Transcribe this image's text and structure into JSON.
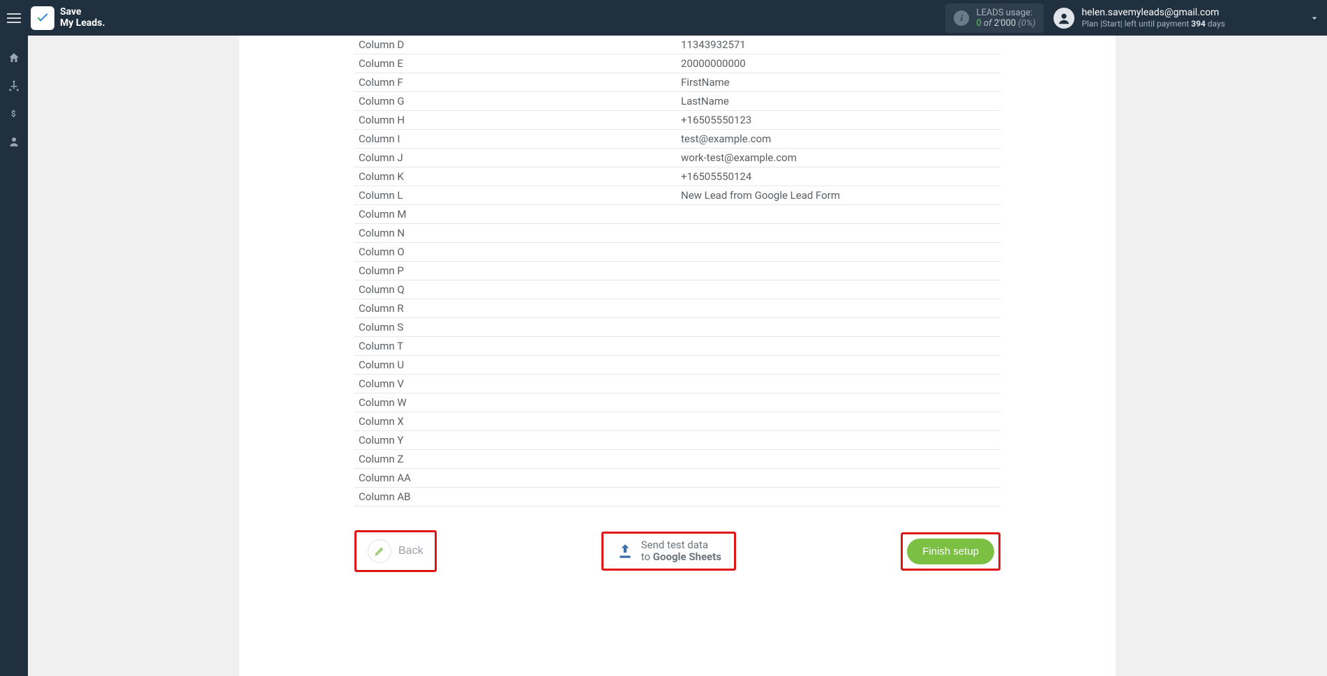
{
  "header": {
    "brand_line1": "Save",
    "brand_line2": "My Leads.",
    "leads_label": "LEADS usage:",
    "leads_value": "0",
    "leads_of": " of ",
    "leads_total": "2'000",
    "leads_pct": " (0%)",
    "user_email": "helen.savemyleads@gmail.com",
    "plan_prefix": "Plan |",
    "plan_name": "Start",
    "plan_mid": "| left until payment ",
    "plan_days_num": "394",
    "plan_days_suffix": " days"
  },
  "columns": [
    {
      "key": "Column D",
      "value": "11343932571"
    },
    {
      "key": "Column E",
      "value": "20000000000"
    },
    {
      "key": "Column F",
      "value": "FirstName"
    },
    {
      "key": "Column G",
      "value": "LastName"
    },
    {
      "key": "Column H",
      "value": "+16505550123"
    },
    {
      "key": "Column I",
      "value": "test@example.com"
    },
    {
      "key": "Column J",
      "value": "work-test@example.com"
    },
    {
      "key": "Column K",
      "value": "+16505550124"
    },
    {
      "key": "Column L",
      "value": "New Lead from Google Lead Form"
    },
    {
      "key": "Column M",
      "value": ""
    },
    {
      "key": "Column N",
      "value": ""
    },
    {
      "key": "Column O",
      "value": ""
    },
    {
      "key": "Column P",
      "value": ""
    },
    {
      "key": "Column Q",
      "value": ""
    },
    {
      "key": "Column R",
      "value": ""
    },
    {
      "key": "Column S",
      "value": ""
    },
    {
      "key": "Column T",
      "value": ""
    },
    {
      "key": "Column U",
      "value": ""
    },
    {
      "key": "Column V",
      "value": ""
    },
    {
      "key": "Column W",
      "value": ""
    },
    {
      "key": "Column X",
      "value": ""
    },
    {
      "key": "Column Y",
      "value": ""
    },
    {
      "key": "Column Z",
      "value": ""
    },
    {
      "key": "Column AA",
      "value": ""
    },
    {
      "key": "Column AB",
      "value": ""
    }
  ],
  "footer": {
    "back": "Back",
    "send_l1": "Send test data",
    "send_l2_prefix": "to ",
    "send_l2_bold": "Google Sheets",
    "finish": "Finish setup"
  }
}
